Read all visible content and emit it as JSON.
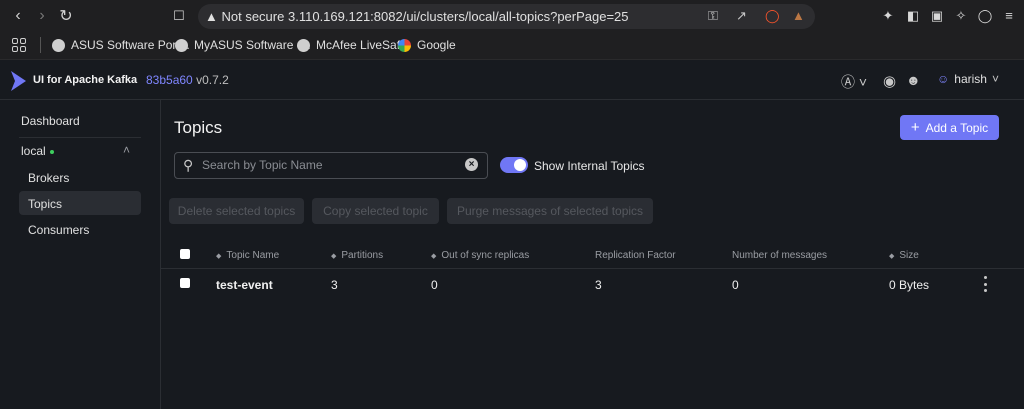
{
  "browser": {
    "url_warning": "Not secure",
    "url": "3.110.169.121:8082/ui/clusters/local/all-topics?perPage=25",
    "bookmarks": [
      {
        "label": "ASUS Software Port...",
        "icon": "globe-icon"
      },
      {
        "label": "MyASUS Software -...",
        "icon": "globe-icon"
      },
      {
        "label": "McAfee LiveSafe",
        "icon": "globe-icon"
      },
      {
        "label": "Google",
        "icon": "google-icon"
      }
    ]
  },
  "app": {
    "brand": "UI for Apache Kafka",
    "hash": "83b5a60",
    "version": "v0.7.2",
    "user": "harish",
    "accent": "#7077f5"
  },
  "sidebar": {
    "dashboard": "Dashboard",
    "cluster": "local",
    "items": [
      {
        "label": "Brokers"
      },
      {
        "label": "Topics"
      },
      {
        "label": "Consumers"
      }
    ]
  },
  "main": {
    "title": "Topics",
    "add_button": "Add a Topic",
    "search_placeholder": "Search by Topic Name",
    "show_internal": "Show Internal Topics",
    "bulk_actions": [
      "Delete selected topics",
      "Copy selected topic",
      "Purge messages of selected topics"
    ]
  },
  "table": {
    "headers": [
      "Topic Name",
      "Partitions",
      "Out of sync replicas",
      "Replication Factor",
      "Number of messages",
      "Size"
    ],
    "rows": [
      {
        "name": "test-event",
        "partitions": "3",
        "out_of_sync": "0",
        "replication": "3",
        "messages": "0",
        "size": "0 Bytes"
      }
    ]
  }
}
